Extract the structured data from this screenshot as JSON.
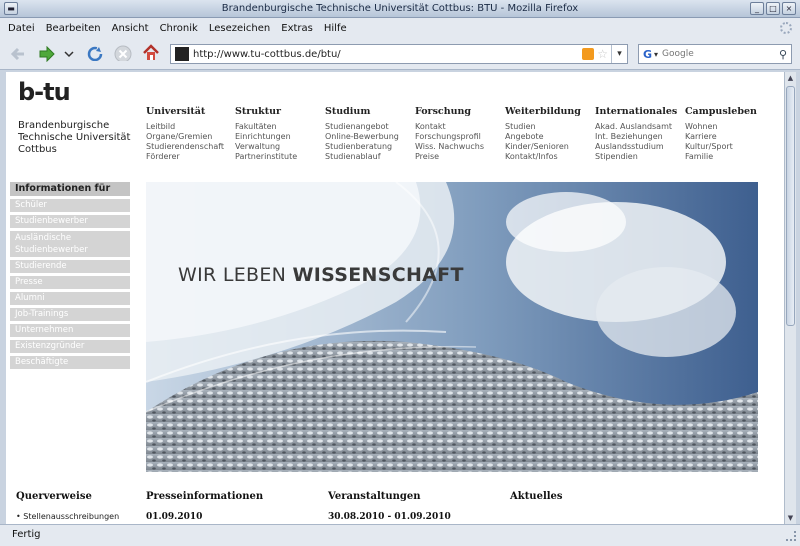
{
  "window": {
    "title": "Brandenburgische Technische Universität Cottbus: BTU - Mozilla Firefox"
  },
  "menu": [
    "Datei",
    "Bearbeiten",
    "Ansicht",
    "Chronik",
    "Lesezeichen",
    "Extras",
    "Hilfe"
  ],
  "address": {
    "url": "http://www.tu-cottbus.de/btu/"
  },
  "search": {
    "engine": "G",
    "placeholder": "Google"
  },
  "site": {
    "logo_mark": "b-tu",
    "logo_line1": "Brandenburgische",
    "logo_line2": "Technische Universität",
    "logo_line3": "Cottbus"
  },
  "topnav": [
    {
      "head": "Universität",
      "links": [
        "Leitbild",
        "Organe/Gremien",
        "Studierendenschaft",
        "Förderer"
      ]
    },
    {
      "head": "Struktur",
      "links": [
        "Fakultäten",
        "Einrichtungen",
        "Verwaltung",
        "Partnerinstitute"
      ]
    },
    {
      "head": "Studium",
      "links": [
        "Studienangebot",
        "Online-Bewerbung",
        "Studienberatung",
        "Studienablauf"
      ]
    },
    {
      "head": "Forschung",
      "links": [
        "Kontakt",
        "Forschungsprofil",
        "Wiss. Nachwuchs",
        "Preise"
      ]
    },
    {
      "head": "Weiterbildung",
      "links": [
        "Studien",
        "Angebote",
        "Kinder/Senioren",
        "Kontakt/Infos"
      ]
    },
    {
      "head": "Internationales",
      "links": [
        "Akad. Auslandsamt",
        "Int. Beziehungen",
        "Auslandsstudium",
        "Stipendien"
      ]
    },
    {
      "head": "Campusleben",
      "links": [
        "Wohnen",
        "Karriere",
        "Kultur/Sport",
        "Familie"
      ]
    }
  ],
  "sidebar": {
    "heading": "Informationen für",
    "items": [
      "Schüler",
      "Studienbewerber",
      "Ausländische Studienbewerber",
      "Studierende",
      "Presse",
      "Alumni",
      "Job-Trainings",
      "Unternehmen",
      "Existenzgründer",
      "Beschäftigte"
    ]
  },
  "hero": {
    "text_light": "WIR LEBEN ",
    "text_bold": "WISSENSCHAFT"
  },
  "bottom": {
    "querverweise": "Querverweise",
    "querverweise_item": "• Stellenausschreibungen",
    "presse": "Presseinformationen",
    "presse_date": "01.09.2010",
    "veranstaltungen": "Veranstaltungen",
    "veranstaltungen_date": "30.08.2010 - 01.09.2010",
    "aktuelles": "Aktuelles"
  },
  "status": "Fertig",
  "colors": {
    "chrome": "#e4e9f0",
    "sidebar_item": "#d4d4d4",
    "sidebar_head": "#c4c4c4"
  }
}
